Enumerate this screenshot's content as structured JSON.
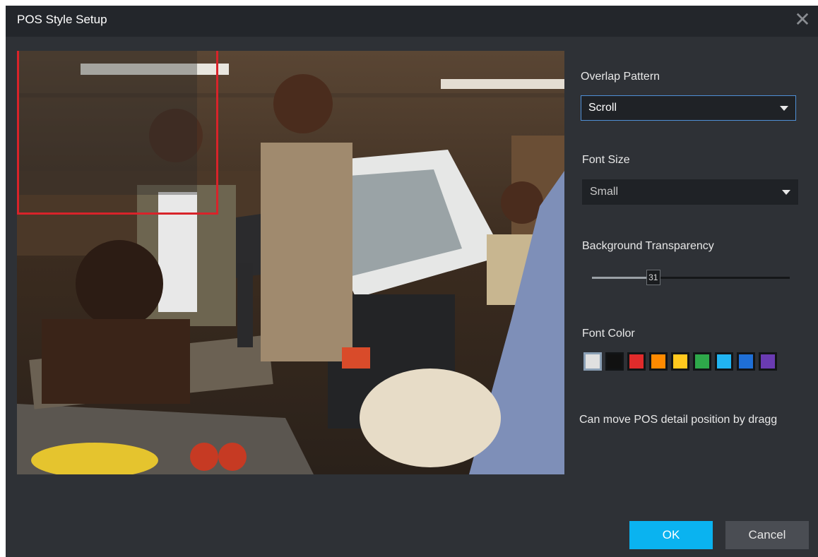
{
  "dialog": {
    "title": "POS Style Setup"
  },
  "overlap_pattern": {
    "label": "Overlap Pattern",
    "value": "Scroll"
  },
  "font_size": {
    "label": "Font Size",
    "value": "Small"
  },
  "background_transparency": {
    "label": "Background Transparency",
    "value": "31"
  },
  "font_color": {
    "label": "Font Color",
    "swatches": [
      {
        "color": "#e0e0e0",
        "selected": true
      },
      {
        "color": "#111111"
      },
      {
        "color": "#e02b2b"
      },
      {
        "color": "#ff8a00"
      },
      {
        "color": "#ffc81e"
      },
      {
        "color": "#2ea84a"
      },
      {
        "color": "#21b4f2"
      },
      {
        "color": "#1f6fd6"
      },
      {
        "color": "#6a3bb2"
      }
    ]
  },
  "hint": "Can move POS detail position by dragg",
  "buttons": {
    "ok": "OK",
    "cancel": "Cancel"
  },
  "colors": {
    "accent": "#0ab3f0",
    "overlay_border": "#d8232a"
  }
}
